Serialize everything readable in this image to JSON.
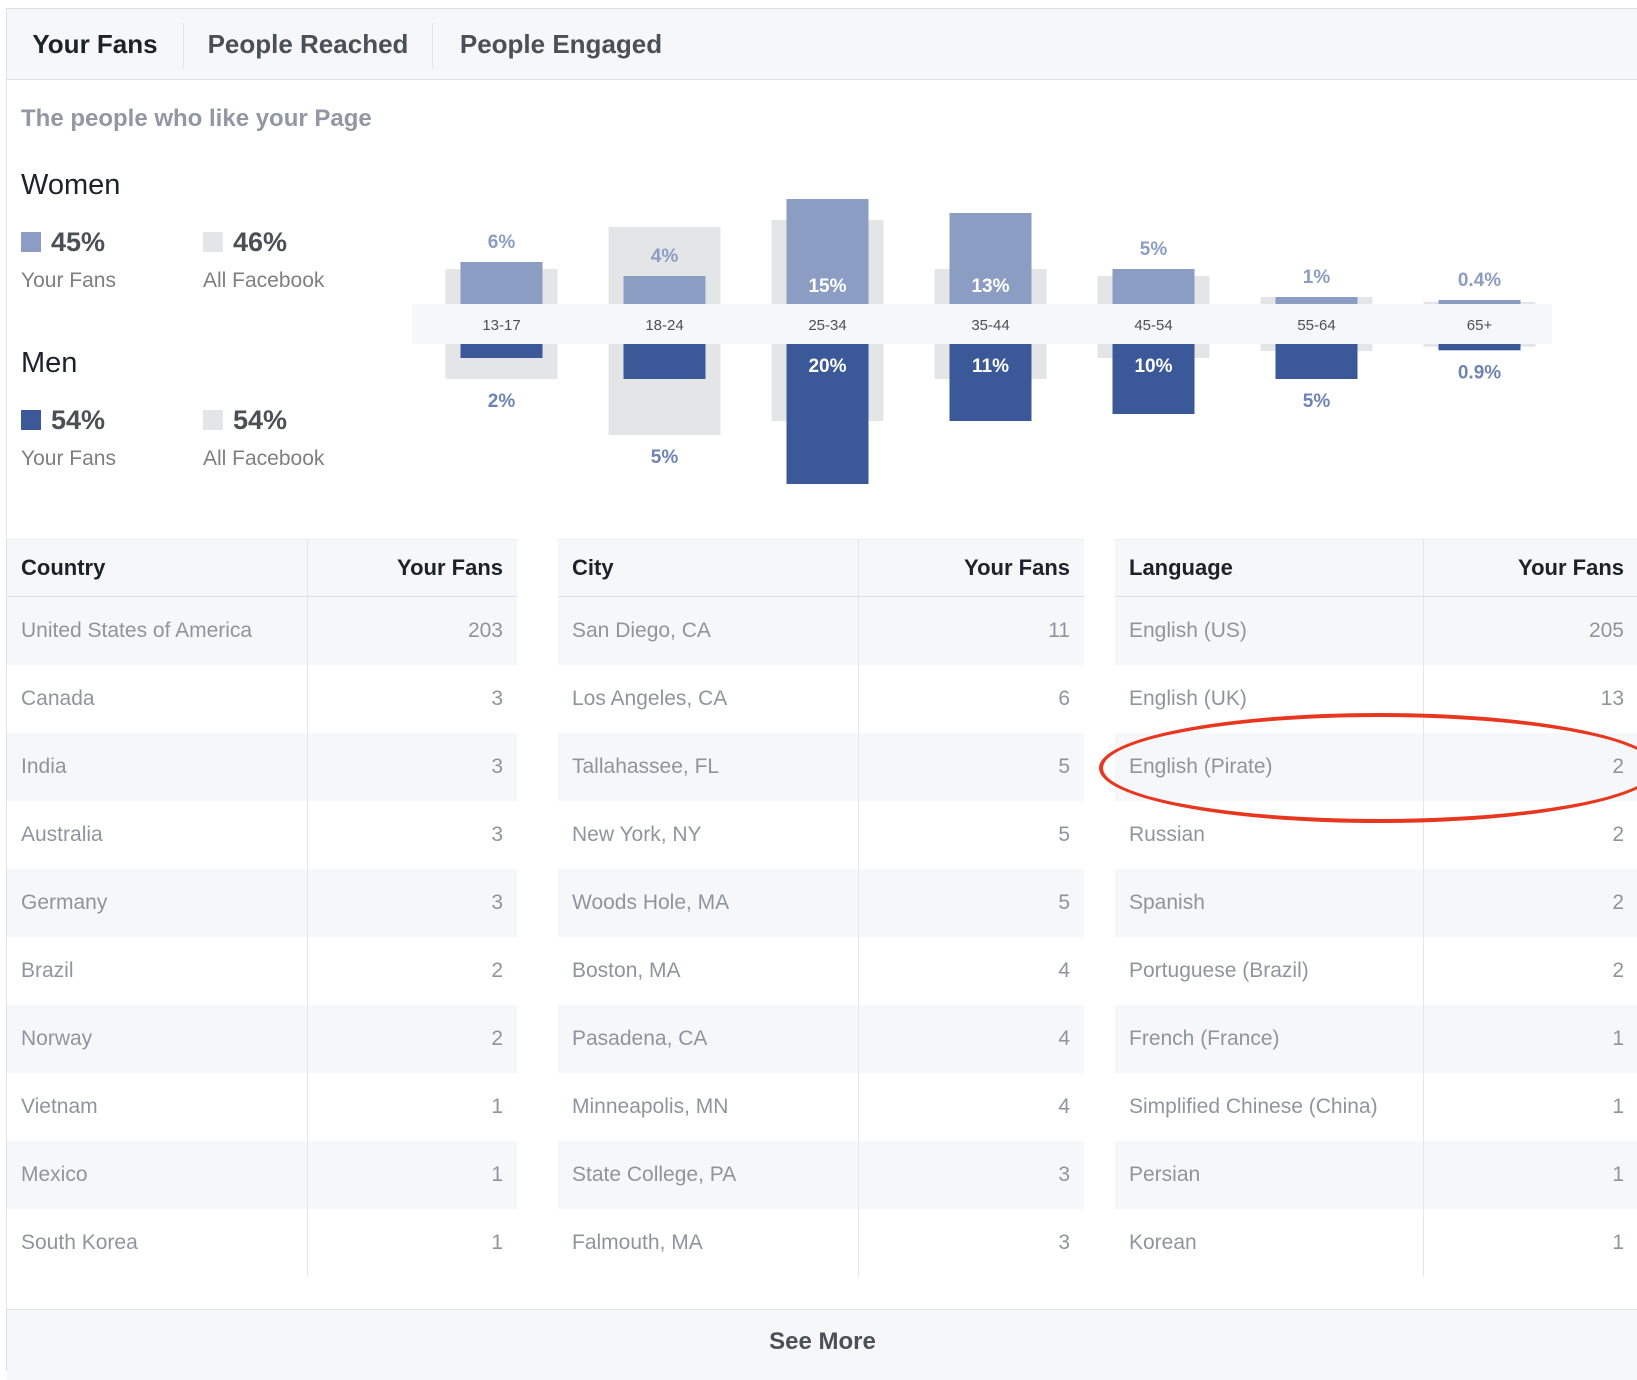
{
  "tabs": [
    "Your Fans",
    "People Reached",
    "People Engaged"
  ],
  "subtitle": "The people who like your Page",
  "gender": {
    "women": {
      "title": "Women",
      "fans_pct": "45%",
      "fans_label": "Your Fans",
      "all_pct": "46%",
      "all_label": "All Facebook"
    },
    "men": {
      "title": "Men",
      "fans_pct": "54%",
      "fans_label": "Your Fans",
      "all_pct": "54%",
      "all_label": "All Facebook"
    }
  },
  "colors": {
    "women": "#8b9dc3",
    "men": "#3b5998",
    "all_facebook": "#e4e5e7",
    "annotation": "#e8361f"
  },
  "chart_data": {
    "type": "bar",
    "categories": [
      "13-17",
      "18-24",
      "25-34",
      "35-44",
      "45-54",
      "55-64",
      "65+"
    ],
    "series": [
      {
        "name": "Women",
        "values": [
          6,
          4,
          15,
          13,
          5,
          1,
          0.4
        ]
      },
      {
        "name": "Men",
        "values": [
          2,
          5,
          20,
          11,
          10,
          5,
          0.9
        ]
      }
    ],
    "women_labels": [
      "6%",
      "4%",
      "15%",
      "13%",
      "5%",
      "1%",
      "0.4%"
    ],
    "men_labels": [
      "2%",
      "5%",
      "20%",
      "11%",
      "10%",
      "5%",
      "0.9%"
    ],
    "all_facebook_women": [
      5,
      11,
      12,
      5,
      4,
      1,
      0.3
    ],
    "all_facebook_men": [
      5,
      13,
      11,
      5,
      2,
      1,
      0.4
    ]
  },
  "tables": [
    {
      "header": [
        "Country",
        "Your Fans"
      ],
      "rows": [
        [
          "United States of America",
          "203"
        ],
        [
          "Canada",
          "3"
        ],
        [
          "India",
          "3"
        ],
        [
          "Australia",
          "3"
        ],
        [
          "Germany",
          "3"
        ],
        [
          "Brazil",
          "2"
        ],
        [
          "Norway",
          "2"
        ],
        [
          "Vietnam",
          "1"
        ],
        [
          "Mexico",
          "1"
        ],
        [
          "South Korea",
          "1"
        ]
      ]
    },
    {
      "header": [
        "City",
        "Your Fans"
      ],
      "rows": [
        [
          "San Diego, CA",
          "11"
        ],
        [
          "Los Angeles, CA",
          "6"
        ],
        [
          "Tallahassee, FL",
          "5"
        ],
        [
          "New York, NY",
          "5"
        ],
        [
          "Woods Hole, MA",
          "5"
        ],
        [
          "Boston, MA",
          "4"
        ],
        [
          "Pasadena, CA",
          "4"
        ],
        [
          "Minneapolis, MN",
          "4"
        ],
        [
          "State College, PA",
          "3"
        ],
        [
          "Falmouth, MA",
          "3"
        ]
      ]
    },
    {
      "header": [
        "Language",
        "Your Fans"
      ],
      "rows": [
        [
          "English (US)",
          "205"
        ],
        [
          "English (UK)",
          "13"
        ],
        [
          "English (Pirate)",
          "2"
        ],
        [
          "Russian",
          "2"
        ],
        [
          "Spanish",
          "2"
        ],
        [
          "Portuguese (Brazil)",
          "2"
        ],
        [
          "French (France)",
          "1"
        ],
        [
          "Simplified Chinese (China)",
          "1"
        ],
        [
          "Persian",
          "1"
        ],
        [
          "Korean",
          "1"
        ]
      ]
    }
  ],
  "see_more": "See More"
}
